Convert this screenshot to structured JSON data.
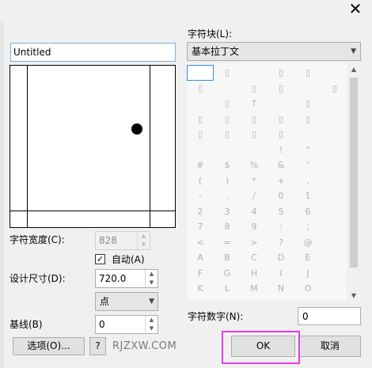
{
  "dialog": {
    "close_symbol": "✕",
    "name_value": "Untitled",
    "char_width_label": "字符宽度(C):",
    "char_width_value": "828",
    "auto_label": "自动(A)",
    "auto_checked": true,
    "check_mark": "✓",
    "design_size_label": "设计尺寸(D):",
    "design_size_value": "720.0",
    "unit_value": "点",
    "baseline_label": "基线(B)",
    "baseline_value": "0",
    "options_label": "选项(O)...",
    "help_label": "?",
    "watermark": "RJZXW.COM",
    "char_block_label": "字符块(L):",
    "char_block_value": "基本拉丁文",
    "char_code_label": "字符数字(N):",
    "char_code_value": "0",
    "ok_label": "OK",
    "cancel_label": "取消"
  },
  "glyph_grid": {
    "rows": [
      [
        "",
        "",
        "",
        "",
        "",
        ""
      ],
      [
        "",
        "",
        "",
        "",
        "",
        ""
      ],
      [
        "",
        "",
        "↑",
        "",
        "",
        ""
      ],
      [
        "",
        "",
        "",
        "",
        "",
        ""
      ],
      [
        "",
        "",
        "",
        "",
        "",
        ""
      ],
      [
        "",
        "",
        "",
        "!",
        "\"",
        ""
      ],
      [
        "#",
        "$",
        "%",
        "&",
        "'",
        ""
      ],
      [
        "(",
        ")",
        "*",
        "+",
        ",",
        ""
      ],
      [
        "-",
        ".",
        "/",
        "0",
        "1",
        ""
      ],
      [
        "2",
        "3",
        "4",
        "5",
        "6",
        ""
      ],
      [
        "7",
        "8",
        "9",
        ":",
        ";",
        ""
      ],
      [
        "<",
        "=",
        ">",
        "?",
        "@",
        ""
      ],
      [
        "A",
        "B",
        "C",
        "D",
        "E",
        ""
      ],
      [
        "F",
        "G",
        "H",
        "I",
        "J",
        ""
      ],
      [
        "K",
        "L",
        "M",
        "N",
        "O",
        ""
      ]
    ],
    "mask": [
      [
        1,
        1,
        0,
        1,
        1,
        0
      ],
      [
        1,
        0,
        1,
        1,
        0,
        1
      ],
      [
        0,
        1,
        1,
        0,
        1,
        0
      ],
      [
        1,
        1,
        1,
        1,
        1,
        0
      ],
      [
        1,
        1,
        1,
        1,
        0,
        0
      ],
      [
        0,
        0,
        0,
        1,
        1,
        0
      ],
      [
        1,
        1,
        1,
        1,
        1,
        0
      ],
      [
        1,
        1,
        1,
        1,
        1,
        0
      ],
      [
        1,
        1,
        1,
        1,
        1,
        0
      ],
      [
        1,
        1,
        1,
        1,
        1,
        0
      ],
      [
        1,
        1,
        1,
        1,
        1,
        0
      ],
      [
        1,
        1,
        1,
        1,
        1,
        0
      ],
      [
        1,
        1,
        1,
        1,
        1,
        0
      ],
      [
        1,
        1,
        1,
        1,
        1,
        0
      ],
      [
        1,
        1,
        1,
        1,
        1,
        0
      ]
    ],
    "placeholder_glyph": "▯",
    "selected_index": 0
  },
  "colors": {
    "highlight": "#e040e8",
    "selection": "#3388ff"
  }
}
